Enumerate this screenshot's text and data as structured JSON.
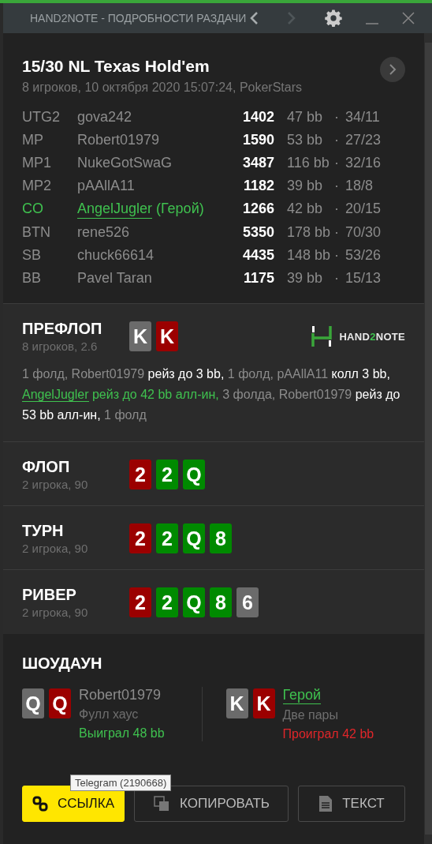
{
  "window": {
    "title": "HAND2NOTE - ПОДРОБНОСТИ РАЗДАЧИ",
    "nav": [
      {
        "kind": "back",
        "disabled": false
      },
      {
        "kind": "forward",
        "disabled": true
      }
    ]
  },
  "hand": {
    "title": "15/30 NL Texas Hold'em",
    "subtitle": "8 игроков, 10 октября 2020 15:07:24, PokerStars"
  },
  "players": [
    {
      "position": "UTG2",
      "name": "gova242",
      "hero": false,
      "stack": "1402",
      "bb": "47 bb",
      "stats": "34/11"
    },
    {
      "position": "MP",
      "name": "Robert01979",
      "hero": false,
      "stack": "1590",
      "bb": "53 bb",
      "stats": "27/23"
    },
    {
      "position": "MP1",
      "name": "NukeGotSwaG",
      "hero": false,
      "stack": "3487",
      "bb": "116 bb",
      "stats": "32/16"
    },
    {
      "position": "MP2",
      "name": "pAAllA11",
      "hero": false,
      "stack": "1182",
      "bb": "39 bb",
      "stats": "18/8"
    },
    {
      "position": "CO",
      "name": "AngelJugler",
      "hero": true,
      "hero_label": "(Герой)",
      "stack": "1266",
      "bb": "42 bb",
      "stats": "20/15"
    },
    {
      "position": "BTN",
      "name": "rene526",
      "hero": false,
      "stack": "5350",
      "bb": "178 bb",
      "stats": "70/30"
    },
    {
      "position": "SB",
      "name": "chuck66614",
      "hero": false,
      "stack": "4435",
      "bb": "148 bb",
      "stats": "53/26"
    },
    {
      "position": "BB",
      "name": "Pavel Taran",
      "hero": false,
      "stack": "1175",
      "bb": "39 bb",
      "stats": "15/13"
    }
  ],
  "separator": "·",
  "streets": [
    {
      "name": "ПРЕФЛОП",
      "subtitle": "8 игроков, 2.6",
      "cards": [
        {
          "rank": "K",
          "color": "#6b6b6b"
        },
        {
          "rank": "K",
          "color": "#9b0000"
        }
      ],
      "logo": [
        {
          "text": "HAND",
          "accent": false
        },
        {
          "text": "2",
          "accent": true
        },
        {
          "text": "NOTE",
          "accent": false
        }
      ],
      "actions": [
        {
          "kind": "muted",
          "text": "1 фолд, Robert01979 "
        },
        {
          "kind": "action",
          "text": "рейз до 3 bb,"
        },
        {
          "kind": "muted",
          "text": " 1 фолд, pAAllA11 "
        },
        {
          "kind": "action",
          "text": "колл 3 bb, "
        },
        {
          "kind": "hero-name",
          "text": "AngelJugler"
        },
        {
          "kind": "hero-action",
          "text": " рейз до 42 bb алл-ин,"
        },
        {
          "kind": "muted",
          "text": " 3 фолда, Robert01979 "
        },
        {
          "kind": "action",
          "text": "рейз до 53 bb алл-ин,"
        },
        {
          "kind": "muted",
          "text": " 1 фолд"
        }
      ]
    },
    {
      "name": "ФЛОП",
      "subtitle": "2 игрока, 90",
      "cards": [
        {
          "rank": "2",
          "color": "#9b0000"
        },
        {
          "rank": "2",
          "color": "#008a00"
        },
        {
          "rank": "Q",
          "color": "#008a00"
        }
      ]
    },
    {
      "name": "ТУРН",
      "subtitle": "2 игрока, 90",
      "cards": [
        {
          "rank": "2",
          "color": "#9b0000"
        },
        {
          "rank": "2",
          "color": "#008a00"
        },
        {
          "rank": "Q",
          "color": "#008a00"
        },
        {
          "rank": "8",
          "color": "#008a00"
        }
      ]
    },
    {
      "name": "РИВЕР",
      "subtitle": "2 игрока, 90",
      "cards": [
        {
          "rank": "2",
          "color": "#9b0000"
        },
        {
          "rank": "2",
          "color": "#008a00"
        },
        {
          "rank": "Q",
          "color": "#008a00"
        },
        {
          "rank": "8",
          "color": "#008a00"
        },
        {
          "rank": "6",
          "color": "#6b6b6b"
        }
      ]
    }
  ],
  "showdown": {
    "title": "ШОУДАУН",
    "hands": [
      {
        "cards": [
          {
            "rank": "Q",
            "color": "#6b6b6b"
          },
          {
            "rank": "Q",
            "color": "#9b0000"
          }
        ],
        "name": "Robert01979",
        "hero": false,
        "combo": "Фулл хаус",
        "result": "Выиграл 48 bb",
        "won": true
      },
      {
        "cards": [
          {
            "rank": "K",
            "color": "#6b6b6b"
          },
          {
            "rank": "K",
            "color": "#9b0000"
          }
        ],
        "name": "Герой",
        "hero": true,
        "combo": "Две пары",
        "result": "Проиграл 42 bb",
        "won": false
      }
    ]
  },
  "buttons": [
    {
      "kind": "link",
      "label": "ССЫЛКА",
      "primary": true
    },
    {
      "kind": "copy",
      "label": "КОПИРОВАТЬ",
      "primary": false
    },
    {
      "kind": "text",
      "label": "ТЕКСТ",
      "primary": false
    }
  ],
  "tooltip": {
    "text": "Telegram (2190668)"
  }
}
